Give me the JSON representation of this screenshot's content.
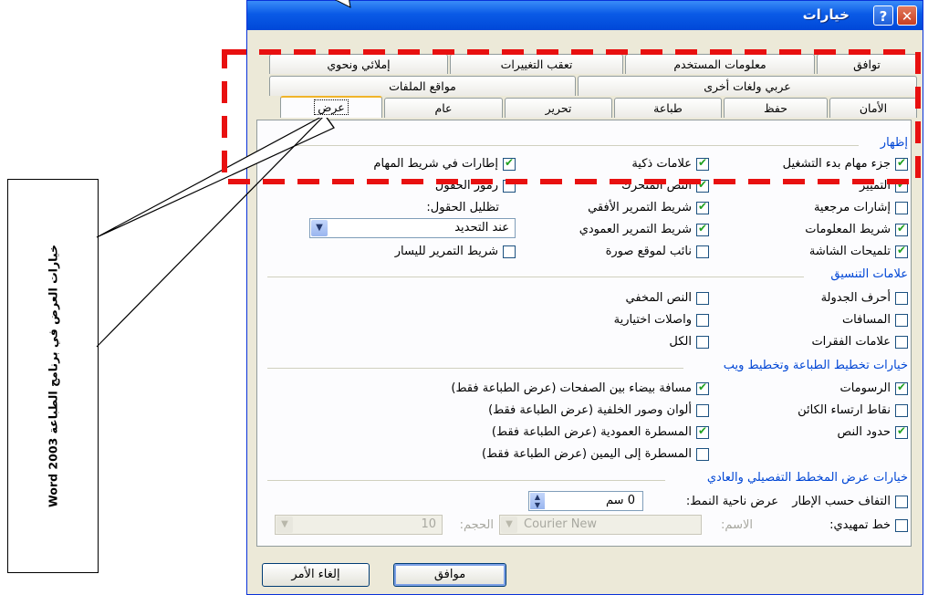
{
  "caption": "خيارات العرض في برنامج الطباعة Word 2003",
  "dialog": {
    "title": "خيارات",
    "help": "?",
    "close": "✕",
    "tabs_row1": [
      "توافق",
      "معلومات المستخدم",
      "تعقب التغييرات",
      "إملائي ونحوي"
    ],
    "tabs_row2": [
      "عربي ولغات أخرى",
      "مواقع الملفات"
    ],
    "tabs_row3": [
      "الأمان",
      "حفظ",
      "طباعة",
      "تحرير",
      "عام",
      "عرض"
    ],
    "show": {
      "title": "إظهار",
      "col1": [
        {
          "label": "جزء مهام بدء التشغيل",
          "checked": true
        },
        {
          "label": "التمييز",
          "checked": true
        },
        {
          "label": "إشارات مرجعية",
          "checked": false
        },
        {
          "label": "شريط المعلومات",
          "checked": true
        },
        {
          "label": "تلميحات الشاشة",
          "checked": true
        }
      ],
      "col2": [
        {
          "label": "علامات ذكية",
          "checked": true
        },
        {
          "label": "النص المتحرك",
          "checked": true
        },
        {
          "label": "شريط التمرير الأفقي",
          "checked": true
        },
        {
          "label": "شريط التمرير العمودي",
          "checked": true
        },
        {
          "label": "نائب لموقع صورة",
          "checked": false
        }
      ],
      "col3": [
        {
          "label": "إطارات في شريط المهام",
          "checked": true
        },
        {
          "label": "رموز الحقول",
          "checked": false
        }
      ],
      "field_shading_label": "تظليل الحقول:",
      "field_shading_value": "عند التحديد",
      "left_scroll": {
        "label": "شريط التمرير لليسار",
        "checked": false
      }
    },
    "formatting": {
      "title": "علامات التنسيق",
      "col1": [
        {
          "label": "أحرف الجدولة",
          "checked": false
        },
        {
          "label": "المسافات",
          "checked": false
        },
        {
          "label": "علامات الفقرات",
          "checked": false
        }
      ],
      "col2": [
        {
          "label": "النص المخفي",
          "checked": false
        },
        {
          "label": "واصلات اختيارية",
          "checked": false
        },
        {
          "label": "الكل",
          "checked": false
        }
      ]
    },
    "print_layout": {
      "title": "خيارات تخطيط الطباعة وتخطيط ويب",
      "col1": [
        {
          "label": "الرسومات",
          "checked": true
        },
        {
          "label": "نقاط ارتساء الكائن",
          "checked": false
        },
        {
          "label": "حدود النص",
          "checked": true
        }
      ],
      "col2": [
        {
          "label": "مسافة بيضاء بين الصفحات (عرض الطباعة فقط)",
          "checked": true
        },
        {
          "label": "ألوان وصور الخلفية (عرض الطباعة فقط)",
          "checked": false
        },
        {
          "label": "المسطرة العمودية (عرض الطباعة فقط)",
          "checked": true
        },
        {
          "label": "المسطرة إلى اليمين (عرض الطباعة فقط)",
          "checked": false
        }
      ]
    },
    "outline": {
      "title": "خيارات عرض المخطط التفصيلي والعادي",
      "wrap": {
        "label": "التفاف حسب الإطار",
        "checked": false
      },
      "style_area_label": "عرض ناحية النمط:",
      "style_area_value": "0 سم",
      "draft": {
        "label": "خط تمهيدي:",
        "checked": false
      },
      "name_label": "الاسم:",
      "name_value": "Courier New",
      "size_label": "الحجم:",
      "size_value": "10"
    },
    "ok": "موافق",
    "cancel": "إلغاء الأمر"
  }
}
